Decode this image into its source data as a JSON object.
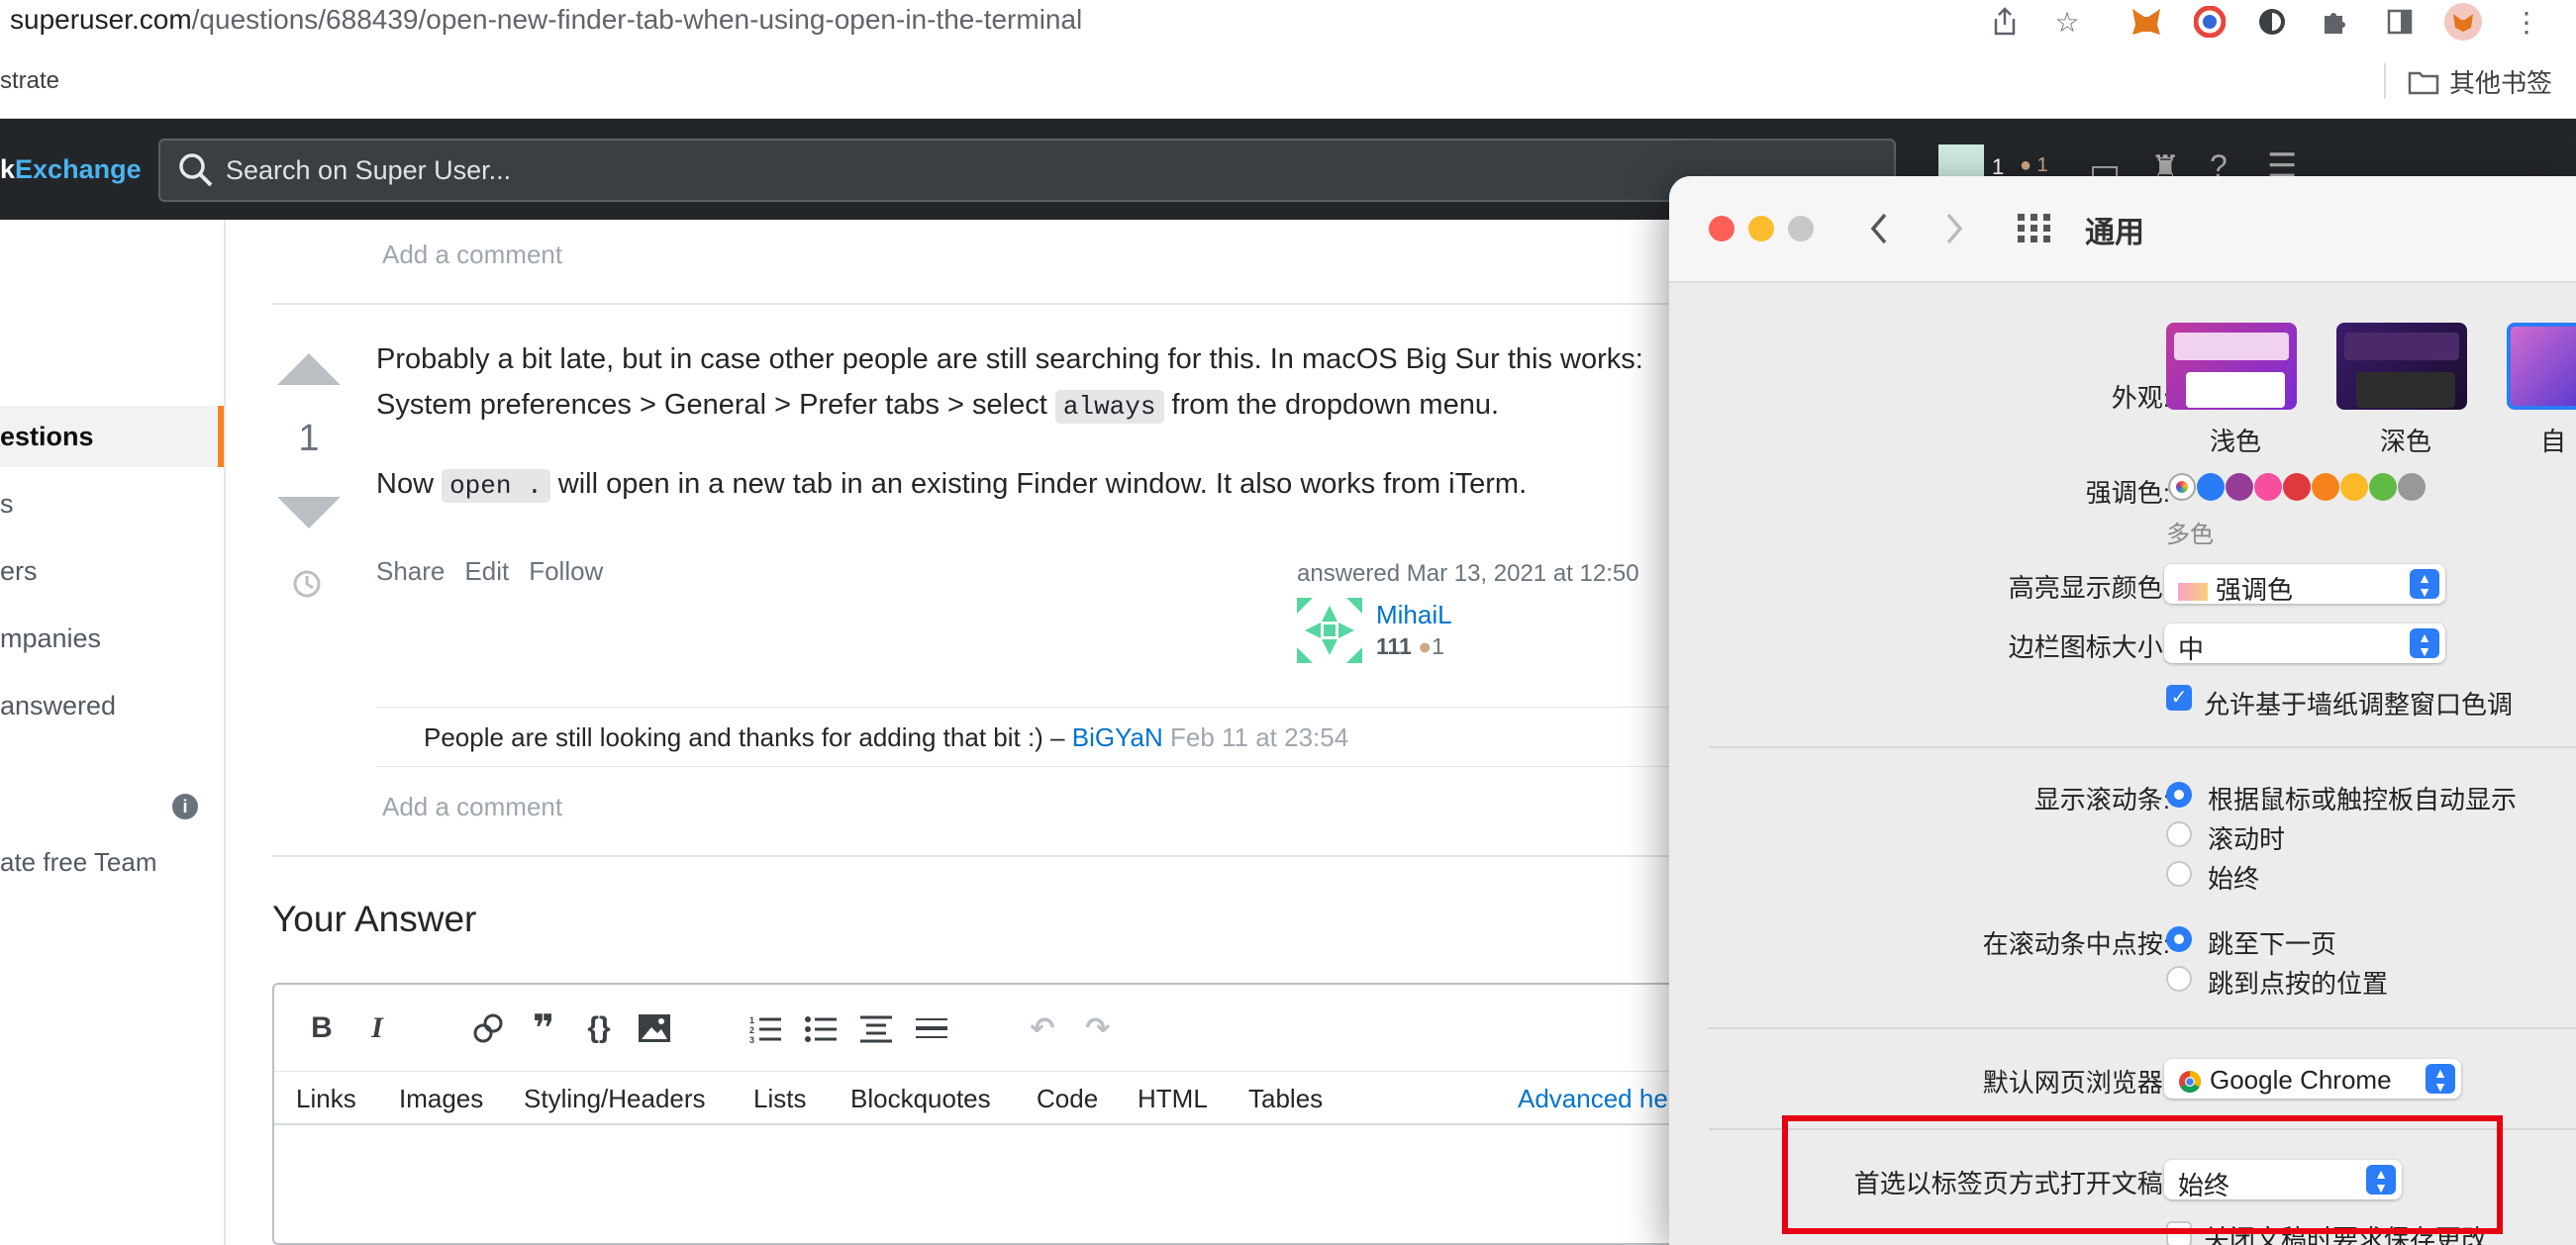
{
  "browser": {
    "url_host": "superuser.com",
    "url_path": "/questions/688439/open-new-finder-tab-when-using-open-in-the-terminal",
    "bookmark_left": "strate",
    "bookmark_right": "其他书签"
  },
  "topbar": {
    "logo_prefix": "k",
    "logo_suffix": "Exchange",
    "search_placeholder": "Search on Super User...",
    "rep": "1",
    "badge": "1"
  },
  "sidebar": {
    "items": [
      {
        "label": "estions"
      },
      {
        "label": "s"
      },
      {
        "label": "ers"
      },
      {
        "label": "mpanies"
      },
      {
        "label": "answered"
      }
    ],
    "team_label": "ate free Team"
  },
  "question_comment": {
    "add_comment": "Add a comment"
  },
  "answer": {
    "score": "1",
    "p1_part1": "Probably a bit late, but in case other people are still searching for this. In macOS Big Sur this works: System preferences > General > Prefer tabs > select ",
    "p1_code": "always",
    "p1_part2": " from the dropdown menu.",
    "p2_part1": "Now ",
    "p2_code": "open .",
    "p2_part2": " will open in a new tab in an existing Finder window. It also works from iTerm.",
    "menu": {
      "share": "Share",
      "edit": "Edit",
      "follow": "Follow"
    },
    "answered": "answered Mar 13, 2021 at 12:50",
    "user": {
      "name": "MihaiL",
      "rep": "111",
      "bronze": "1"
    },
    "comment": {
      "text": "People are still looking and thanks for adding that bit :) – ",
      "user": "BiGYaN",
      "date": "Feb 11 at 23:54"
    },
    "add_comment": "Add a comment"
  },
  "your_answer": {
    "heading": "Your Answer",
    "tabs": [
      "Links",
      "Images",
      "Styling/Headers",
      "Lists",
      "Blockquotes",
      "Code",
      "HTML",
      "Tables"
    ],
    "advanced": "Advanced he"
  },
  "prefs": {
    "title": "通用",
    "appearance_label": "外观:",
    "appearance_options": [
      "浅色",
      "深色",
      "自"
    ],
    "accent_label": "强调色:",
    "accent_value": "多色",
    "accent_colors": [
      "#ff5257",
      "#2a7cf6",
      "#953d96",
      "#f74f9e",
      "#e0383e",
      "#f7821b",
      "#fcb827",
      "#62ba46",
      "#989898"
    ],
    "highlight_label": "高亮显示颜色:",
    "highlight_value": "强调色",
    "sidebar_icon_label": "边栏图标大小:",
    "sidebar_icon_value": "中",
    "tint_checkbox": "允许基于墙纸调整窗口色调",
    "scrollbars_label": "显示滚动条:",
    "scrollbars_options": [
      "根据鼠标或触控板自动显示",
      "滚动时",
      "始终"
    ],
    "click_label": "在滚动条中点按:",
    "click_options": [
      "跳至下一页",
      "跳到点按的位置"
    ],
    "browser_label": "默认网页浏览器:",
    "browser_value": "Google Chrome",
    "tabs_label": "首选以标签页方式打开文稿:",
    "tabs_value": "始终",
    "close_partial": "关闭文稿时要求保存更改"
  }
}
